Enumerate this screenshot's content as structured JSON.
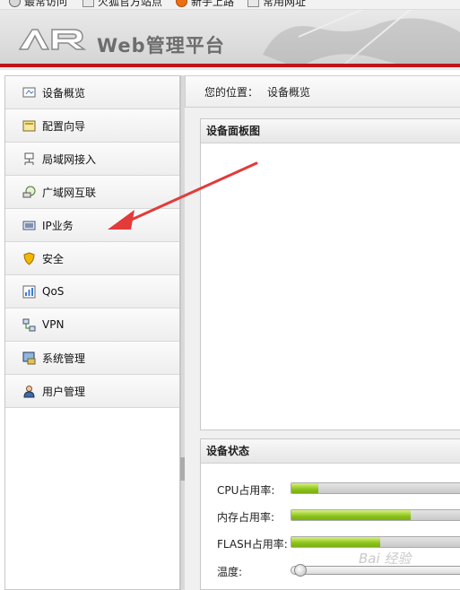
{
  "bookmarks": [
    {
      "label": "最常访问",
      "icon": "gear-icon"
    },
    {
      "label": "火狐官方站点",
      "icon": "page-icon"
    },
    {
      "label": "新手上路",
      "icon": "firefox-icon"
    },
    {
      "label": "常用网址",
      "icon": "page-icon"
    }
  ],
  "header": {
    "logo_text": "AR",
    "title": "Web管理平台",
    "accent_color": "#c0141a"
  },
  "sidebar": {
    "items": [
      {
        "label": "设备概览",
        "icon": "device-overview-icon"
      },
      {
        "label": "配置向导",
        "icon": "wizard-icon"
      },
      {
        "label": "局域网接入",
        "icon": "lan-icon"
      },
      {
        "label": "广域网互联",
        "icon": "wan-icon"
      },
      {
        "label": "IP业务",
        "icon": "ip-service-icon"
      },
      {
        "label": "安全",
        "icon": "shield-icon"
      },
      {
        "label": "QoS",
        "icon": "qos-icon"
      },
      {
        "label": "VPN",
        "icon": "vpn-icon"
      },
      {
        "label": "系统管理",
        "icon": "system-management-icon"
      },
      {
        "label": "用户管理",
        "icon": "user-management-icon"
      }
    ]
  },
  "location": {
    "prefix": "您的位置：",
    "current": "设备概览"
  },
  "device_panel": {
    "title": "设备面板图"
  },
  "device_status": {
    "title": "设备状态",
    "metrics": [
      {
        "label": "CPU占用率:",
        "fraction": 0.15
      },
      {
        "label": "内存占用率:",
        "fraction": 0.67
      },
      {
        "label": "FLASH占用率:",
        "fraction": 0.5
      },
      {
        "label": "温度:",
        "type": "slider"
      }
    ],
    "bar_color": "#8cc21a"
  },
  "watermark": "Bai 经验"
}
